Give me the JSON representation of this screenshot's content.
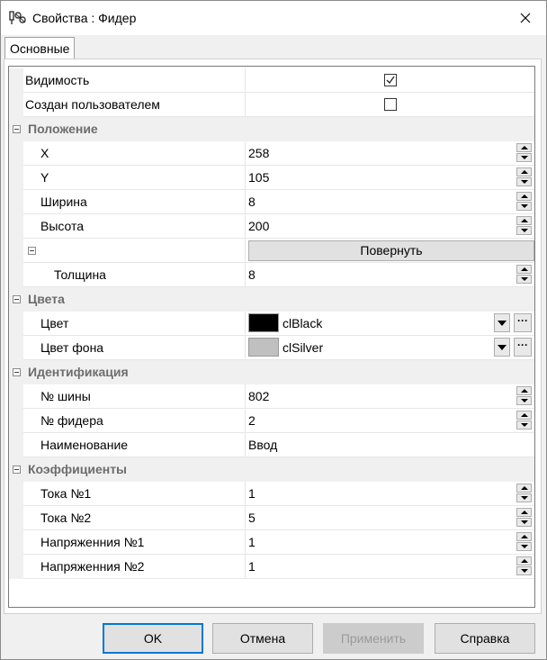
{
  "window": {
    "title": "Свойства : Фидер"
  },
  "tabs": [
    {
      "label": "Основные"
    }
  ],
  "rows": [
    {
      "kind": "prop",
      "indent": 1,
      "name": "Видимость",
      "editor": "checkbox",
      "checked": true
    },
    {
      "kind": "prop",
      "indent": 1,
      "name": "Создан пользователем",
      "editor": "checkbox",
      "checked": false
    },
    {
      "kind": "cat",
      "name": "Положение"
    },
    {
      "kind": "prop",
      "indent": 2,
      "name": "X",
      "editor": "spin",
      "value": "258"
    },
    {
      "kind": "prop",
      "indent": 2,
      "name": "Y",
      "editor": "spin",
      "value": "105"
    },
    {
      "kind": "prop",
      "indent": 2,
      "name": "Ширина",
      "editor": "spin",
      "value": "8"
    },
    {
      "kind": "prop",
      "indent": 2,
      "name": "Высота",
      "editor": "spin",
      "value": "200"
    },
    {
      "kind": "subgroup",
      "indent": 2,
      "name": "",
      "editor": "button",
      "value": "Повернуть"
    },
    {
      "kind": "prop",
      "indent": 3,
      "name": "Толщина",
      "editor": "spin",
      "value": "8"
    },
    {
      "kind": "cat",
      "name": "Цвета"
    },
    {
      "kind": "prop",
      "indent": 2,
      "name": "Цвет",
      "editor": "color",
      "value": "clBlack",
      "swatch": "#000000"
    },
    {
      "kind": "prop",
      "indent": 2,
      "name": "Цвет фона",
      "editor": "color",
      "value": "clSilver",
      "swatch": "#c0c0c0"
    },
    {
      "kind": "cat",
      "name": "Идентификация"
    },
    {
      "kind": "prop",
      "indent": 2,
      "name": "№ шины",
      "editor": "spin",
      "value": "802"
    },
    {
      "kind": "prop",
      "indent": 2,
      "name": "№ фидера",
      "editor": "spin",
      "value": "2"
    },
    {
      "kind": "prop",
      "indent": 2,
      "name": "Наименование",
      "editor": "text",
      "value": "Ввод"
    },
    {
      "kind": "cat",
      "name": "Коэффициенты"
    },
    {
      "kind": "prop",
      "indent": 2,
      "name": "Тока №1",
      "editor": "spin",
      "value": "1"
    },
    {
      "kind": "prop",
      "indent": 2,
      "name": "Тока №2",
      "editor": "spin",
      "value": "5"
    },
    {
      "kind": "prop",
      "indent": 2,
      "name": "Напряженния №1",
      "editor": "spin",
      "value": "1"
    },
    {
      "kind": "prop",
      "indent": 2,
      "name": "Напряженния №2",
      "editor": "spin",
      "value": "1"
    }
  ],
  "buttons": {
    "ok": "OK",
    "cancel": "Отмена",
    "apply": "Применить",
    "help": "Справка"
  },
  "icons": {
    "app": "feeder-properties-icon",
    "close": "close-icon"
  }
}
